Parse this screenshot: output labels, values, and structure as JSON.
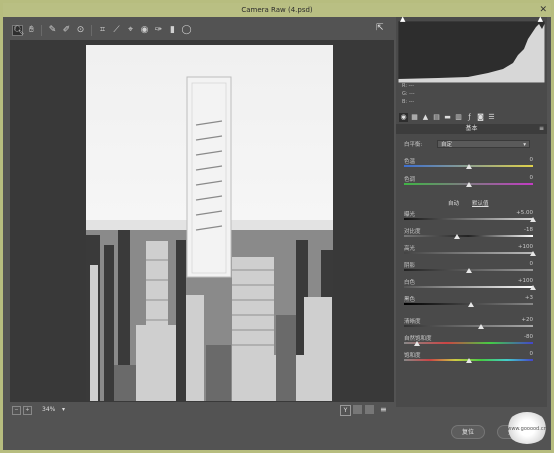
{
  "window": {
    "title": "Camera Raw (4.psd)"
  },
  "toolbar": {
    "tools": [
      "zoom-tool",
      "hand-tool",
      "white-balance-tool",
      "color-sampler-tool",
      "targeted-adjustment-tool",
      "crop-tool",
      "straighten-tool",
      "spot-removal-tool",
      "red-eye-tool",
      "adjustment-brush-tool",
      "graduated-filter-tool",
      "radial-filter-tool"
    ]
  },
  "status": {
    "zoom": "34%"
  },
  "histogram": {
    "r": "R: ---",
    "g": "G: ---",
    "b": "B: ---"
  },
  "panel": {
    "title": "基本",
    "wb": {
      "label": "白平衡:",
      "value": "自定"
    },
    "temp": {
      "label": "色温",
      "value": "0",
      "level": 0.5
    },
    "tint": {
      "label": "色调",
      "value": "0",
      "level": 0.5
    },
    "auto": "自动",
    "default": "默认值",
    "exposure": {
      "label": "曝光",
      "value": "+5.00",
      "level": 1.0
    },
    "contrast": {
      "label": "对比度",
      "value": "-18",
      "level": 0.41
    },
    "highlights": {
      "label": "高光",
      "value": "+100",
      "level": 1.0
    },
    "shadows": {
      "label": "阴影",
      "value": "0",
      "level": 0.5
    },
    "whites": {
      "label": "白色",
      "value": "+100",
      "level": 1.0
    },
    "blacks": {
      "label": "黑色",
      "value": "+3",
      "level": 0.52
    },
    "clarity": {
      "label": "清晰度",
      "value": "+20",
      "level": 0.6
    },
    "vibrance": {
      "label": "自然饱和度",
      "value": "-80",
      "level": 0.1
    },
    "saturation": {
      "label": "饱和度",
      "value": "0",
      "level": 0.5
    }
  },
  "buttons": {
    "reset": "复位",
    "done": "完成"
  },
  "watermark": "www.gooood.cn"
}
